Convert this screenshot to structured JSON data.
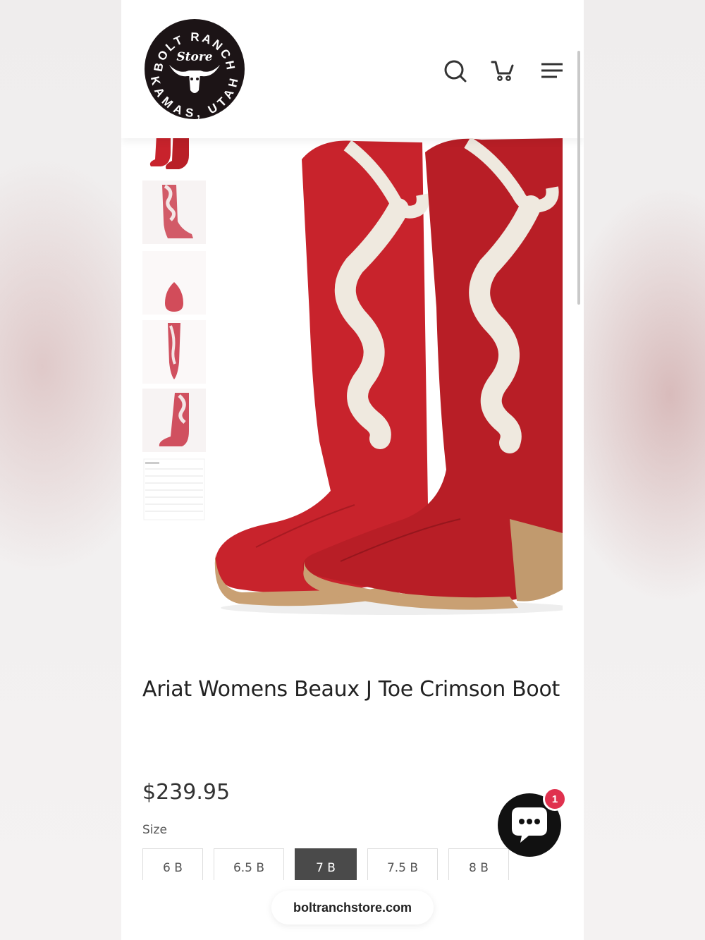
{
  "logo": {
    "top_text": "BOLT RANCH",
    "middle_text": "Store",
    "bottom_text": "KAMAS, UTAH"
  },
  "header_icons": [
    "search-icon",
    "cart-icon",
    "menu-icon"
  ],
  "product": {
    "title": "Ariat Womens Beaux J Toe Crimson Boot",
    "price": "$239.95",
    "size_label": "Size",
    "sizes": [
      "6 B",
      "6.5 B",
      "7 B",
      "7.5 B",
      "8 B"
    ],
    "selected_size": "7 B"
  },
  "chat": {
    "badge_count": "1"
  },
  "browser": {
    "url": "boltranchstore.com"
  },
  "colors": {
    "boot_red": "#c8232c",
    "bow_cream": "#efe9df",
    "selected_size_bg": "#4a4a4a",
    "badge_red": "#e0314e"
  }
}
